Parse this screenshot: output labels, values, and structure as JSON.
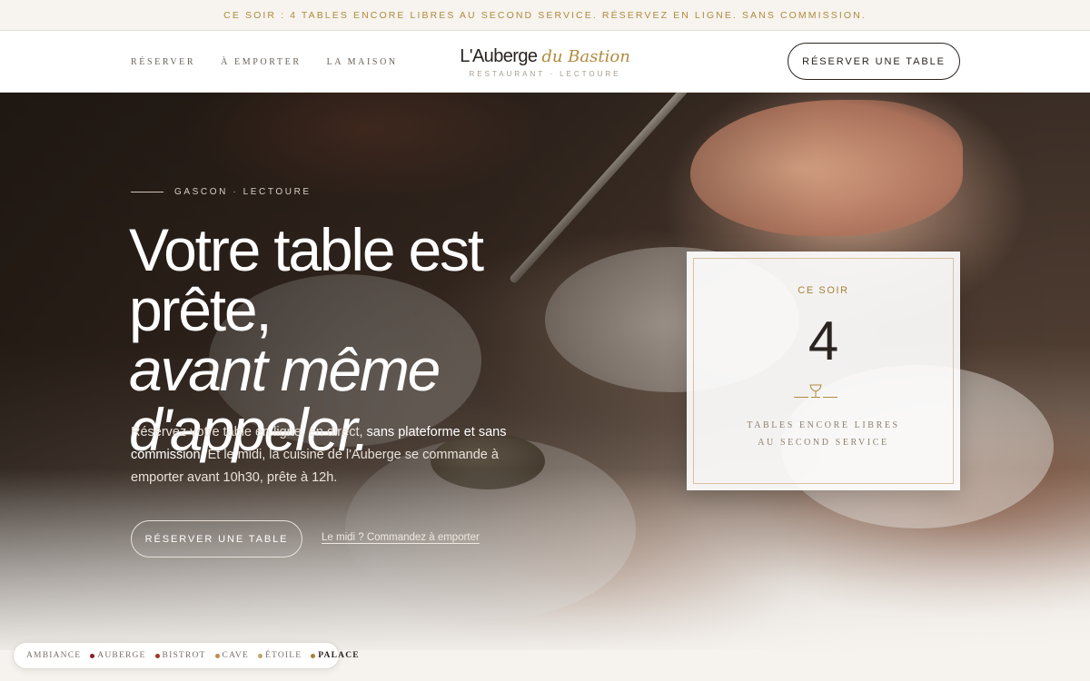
{
  "announcement": "CE SOIR : 4 TABLES ENCORE LIBRES AU SECOND SERVICE. RÉSERVEZ EN LIGNE. SANS COMMISSION.",
  "nav": {
    "links": [
      "RÉSERVER",
      "À EMPORTER",
      "LA MAISON"
    ],
    "brand_main": "L'Auberge",
    "brand_script": "du Bastion",
    "brand_sub": "RESTAURANT · LECTOURE",
    "cta": "RÉSERVER UNE TABLE"
  },
  "hero": {
    "eyebrow": "GASCON · LECTOURE",
    "headline_1": "Votre table est prête,",
    "headline_2": "avant même",
    "headline_3": "d'appeler.",
    "lede_1": "Réservez votre table en ligne, en direct, ",
    "lede_bold": "sans plateforme et sans commission.",
    "lede_2": " Et le midi, la cuisine de l'Auberge se commande à emporter avant 10h30, prête à 12h.",
    "cta": "RÉSERVER UNE TABLE",
    "link": "Le midi ? Commandez à emporter"
  },
  "availability": {
    "kicker": "CE SOIR",
    "count": "4",
    "caption_1": "TABLES ENCORE LIBRES",
    "caption_2": "AU SECOND SERVICE",
    "icon": "wine-glass-icon"
  },
  "theme_switcher": {
    "label": "AMBIANCE",
    "options": [
      {
        "label": "AUBERGE",
        "color": "#8b1e1e"
      },
      {
        "label": "BISTROT",
        "color": "#a4352a"
      },
      {
        "label": "CAVE",
        "color": "#c08a4a"
      },
      {
        "label": "ÉTOILE",
        "color": "#c2a46a"
      },
      {
        "label": "PALACE",
        "color": "#a8813b",
        "active": true
      }
    ]
  },
  "colors": {
    "accent": "#b08a3e",
    "ink": "#2a2420"
  }
}
